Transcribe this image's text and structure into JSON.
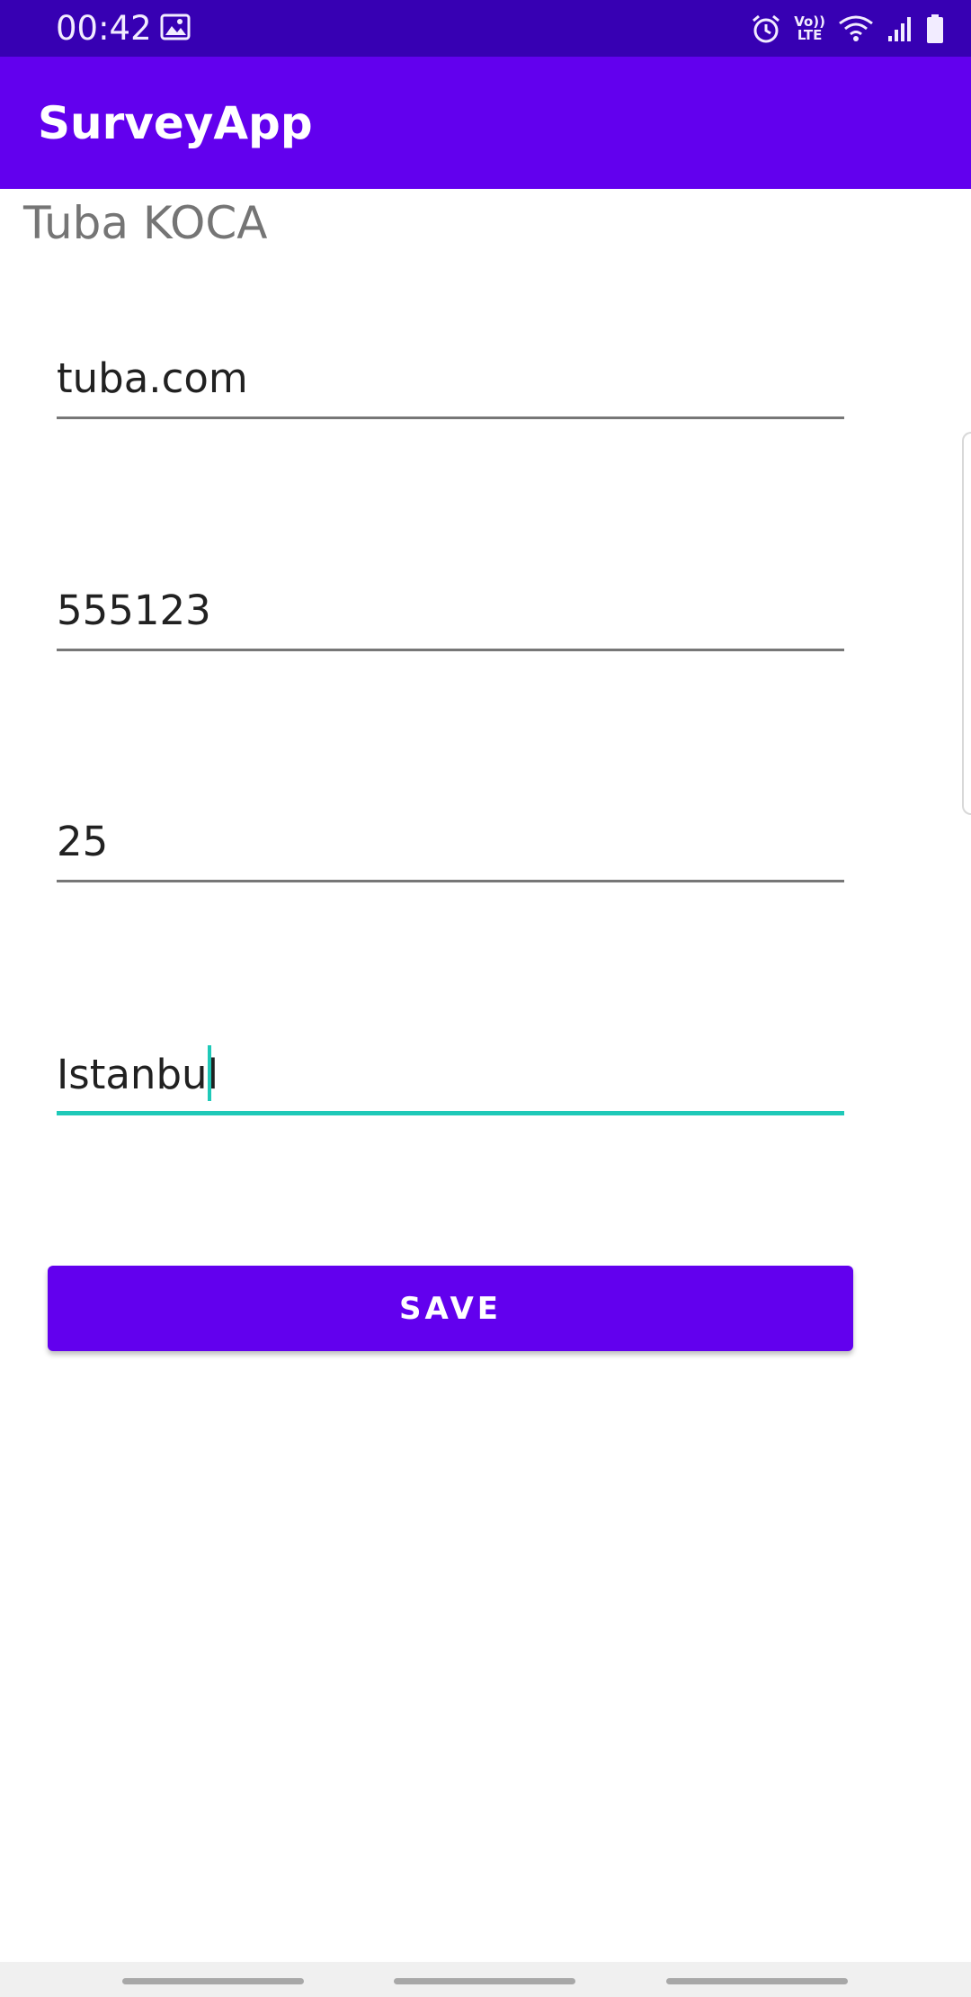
{
  "status_bar": {
    "time": "00:42",
    "icons": [
      "image-icon",
      "alarm-icon",
      "volte-icon",
      "wifi-icon",
      "signal-icon",
      "battery-icon"
    ],
    "volte_top": "Vo))",
    "volte_bottom": "LTE"
  },
  "app_bar": {
    "title": "SurveyApp"
  },
  "content": {
    "name": "Tuba KOCA",
    "fields": [
      {
        "value": "tuba.com"
      },
      {
        "value": "555123"
      },
      {
        "value": "25"
      },
      {
        "value": "Istanbul"
      }
    ],
    "save_label": "SAVE"
  },
  "colors": {
    "status_bar": "#3700b3",
    "primary": "#6200ee",
    "focus_accent": "#1fc9b8"
  }
}
